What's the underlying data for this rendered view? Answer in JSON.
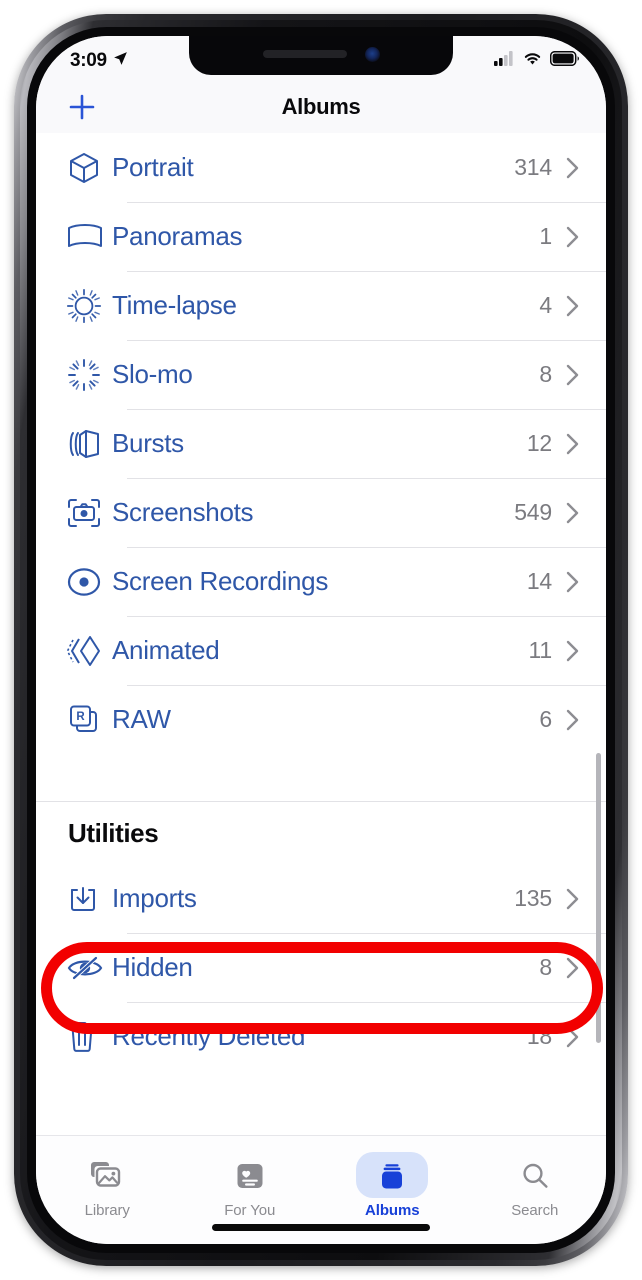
{
  "status_bar": {
    "time": "3:09",
    "location_icon": "location-arrow-icon",
    "signal_icon": "cellular-signal-icon",
    "signal_bars_filled": 2,
    "signal_bars_total": 4,
    "wifi_icon": "wifi-icon",
    "battery_icon": "battery-icon",
    "battery_level_pct": 88
  },
  "nav_bar": {
    "add_label": "+",
    "title": "Albums"
  },
  "list": {
    "items": [
      {
        "icon": "portrait-cube-icon",
        "label": "Portrait",
        "count": "314",
        "chevron": "chevron-right-icon"
      },
      {
        "icon": "panorama-icon",
        "label": "Panoramas",
        "count": "1",
        "chevron": "chevron-right-icon"
      },
      {
        "icon": "timelapse-icon",
        "label": "Time-lapse",
        "count": "4",
        "chevron": "chevron-right-icon"
      },
      {
        "icon": "slomo-icon",
        "label": "Slo-mo",
        "count": "8",
        "chevron": "chevron-right-icon"
      },
      {
        "icon": "bursts-icon",
        "label": "Bursts",
        "count": "12",
        "chevron": "chevron-right-icon"
      },
      {
        "icon": "screenshots-camera-icon",
        "label": "Screenshots",
        "count": "549",
        "chevron": "chevron-right-icon"
      },
      {
        "icon": "screen-recordings-icon",
        "label": "Screen Recordings",
        "count": "14",
        "chevron": "chevron-right-icon"
      },
      {
        "icon": "animated-icon",
        "label": "Animated",
        "count": "11",
        "chevron": "chevron-right-icon"
      },
      {
        "icon": "raw-icon",
        "label": "RAW",
        "count": "6",
        "chevron": "chevron-right-icon"
      }
    ]
  },
  "utilities": {
    "header": "Utilities",
    "items": [
      {
        "icon": "imports-download-icon",
        "label": "Imports",
        "count": "135",
        "chevron": "chevron-right-icon"
      },
      {
        "icon": "hidden-eye-slash-icon",
        "label": "Hidden",
        "count": "8",
        "chevron": "chevron-right-icon"
      },
      {
        "icon": "trash-icon",
        "label": "Recently Deleted",
        "count": "18",
        "chevron": "chevron-right-icon"
      }
    ]
  },
  "annotation": {
    "target_label": "Hidden",
    "shape": "oval-outline",
    "color": "#F20000"
  },
  "tab_bar": {
    "active": "Albums",
    "tabs": [
      {
        "icon": "library-photos-icon",
        "label": "Library",
        "active": false
      },
      {
        "icon": "for-you-heart-icon",
        "label": "For You",
        "active": false
      },
      {
        "icon": "albums-stack-icon",
        "label": "Albums",
        "active": true
      },
      {
        "icon": "search-magnifier-icon",
        "label": "Search",
        "active": false
      }
    ]
  },
  "colors": {
    "link_blue": "#2F57A8",
    "tab_active_blue": "#1841D8",
    "tab_pill_bg": "#D7E2FA",
    "count_gray": "#7B7B80",
    "annotation_red": "#F20000"
  }
}
